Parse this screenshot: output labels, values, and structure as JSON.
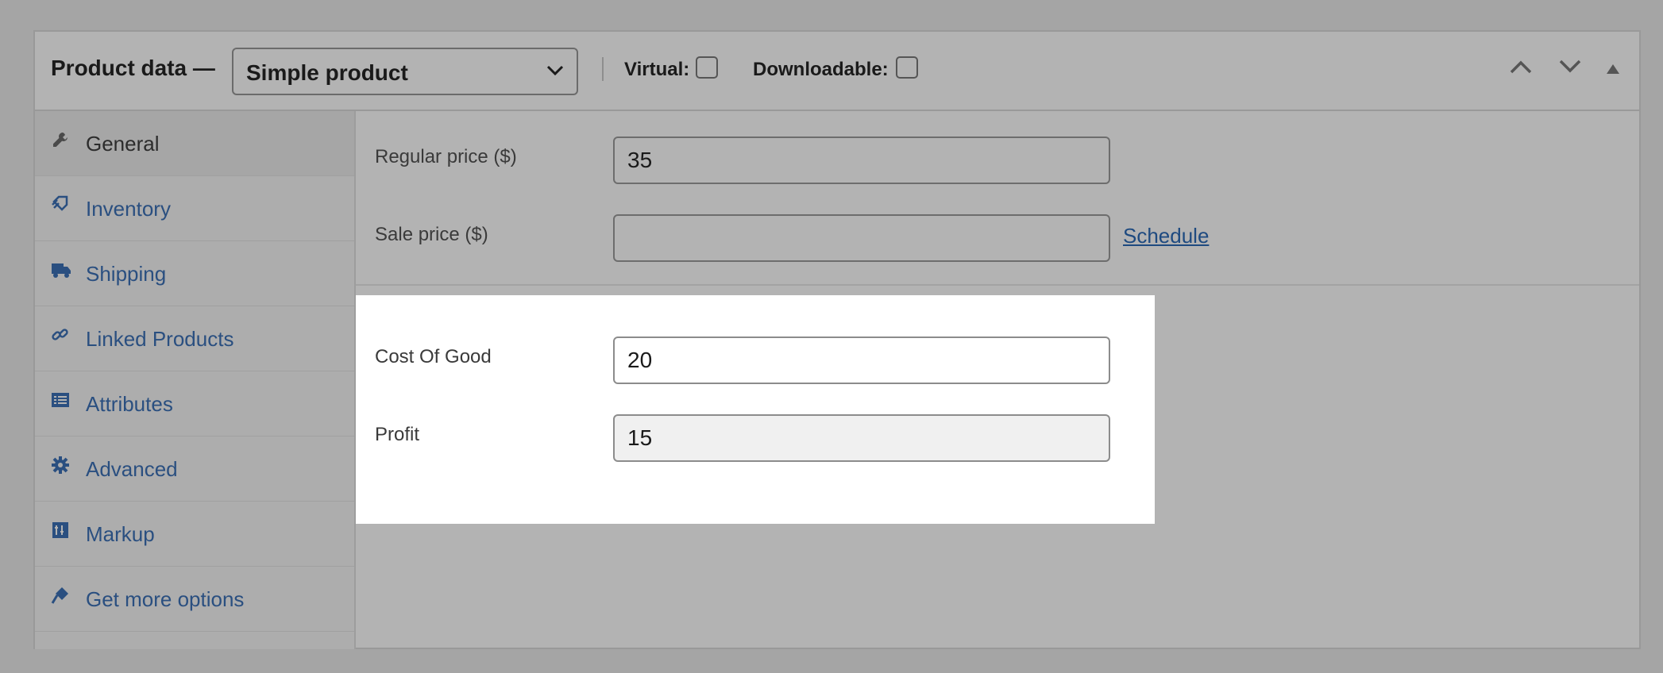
{
  "header": {
    "title": "Product data —",
    "product_type": "Simple product",
    "virtual_label": "Virtual:",
    "downloadable_label": "Downloadable:"
  },
  "tabs": [
    {
      "label": "General",
      "icon": "wrench-icon",
      "active": true
    },
    {
      "label": "Inventory",
      "icon": "tag-icon"
    },
    {
      "label": "Shipping",
      "icon": "truck-icon"
    },
    {
      "label": "Linked Products",
      "icon": "link-icon"
    },
    {
      "label": "Attributes",
      "icon": "list-icon"
    },
    {
      "label": "Advanced",
      "icon": "gear-icon"
    },
    {
      "label": "Markup",
      "icon": "markup-icon"
    },
    {
      "label": "Get more options",
      "icon": "plug-icon"
    }
  ],
  "fields": {
    "regular_price": {
      "label": "Regular price ($)",
      "value": "35"
    },
    "sale_price": {
      "label": "Sale price ($)",
      "value": "",
      "schedule_link": "Schedule"
    },
    "cost_of_good": {
      "label": "Cost Of Good",
      "value": "20"
    },
    "profit": {
      "label": "Profit",
      "value": "15"
    }
  },
  "colors": {
    "link": "#1e4a80",
    "highlight_bg": "#ffffff",
    "overlay_bg": "#b3b3b3"
  }
}
